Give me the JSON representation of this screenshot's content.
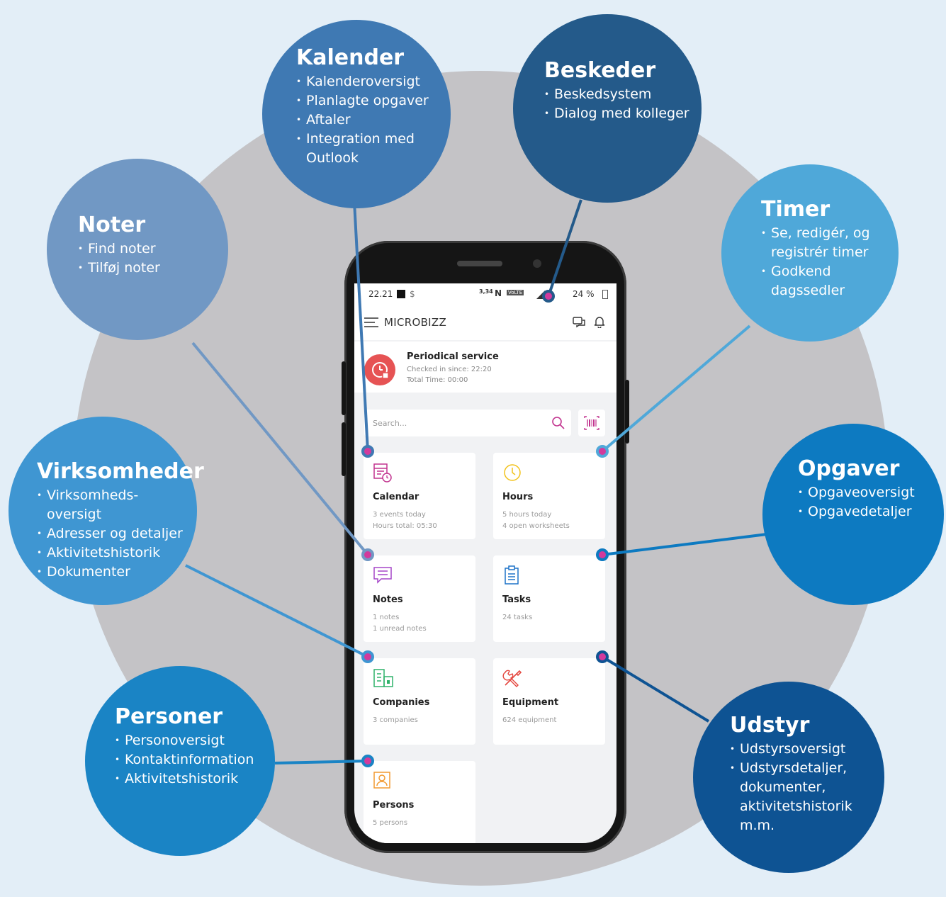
{
  "features": {
    "kalender": {
      "title": "Kalender",
      "items": [
        "Kalenderoversigt",
        "Planlagte opgaver",
        "Aftaler",
        "Integration med Outlook"
      ]
    },
    "beskeder": {
      "title": "Beskeder",
      "items": [
        "Beskedsystem",
        "Dialog med kolleger"
      ]
    },
    "noter": {
      "title": "Noter",
      "items": [
        "Find noter",
        "Tilføj noter"
      ]
    },
    "timer": {
      "title": "Timer",
      "items": [
        "Se, redigér, og registrér timer",
        "Godkend dagssedler"
      ]
    },
    "virksomheder": {
      "title": "Virksomheder",
      "items": [
        "Virksomheds-oversigt",
        "Adresser og detaljer",
        "Aktivitetshistorik",
        "Dokumenter"
      ]
    },
    "opgaver": {
      "title": "Opgaver",
      "items": [
        "Opgaveoversigt",
        "Opgavedetaljer"
      ]
    },
    "personer": {
      "title": "Personer",
      "items": [
        "Personoversigt",
        "Kontaktinformation",
        "Aktivitetshistorik"
      ]
    },
    "udstyr": {
      "title": "Udstyr",
      "items": [
        "Udstyrsoversigt",
        "Udstyrsdetaljer, dokumenter, aktivitetshistorik m.m."
      ]
    }
  },
  "app": {
    "status": {
      "time": "22.21",
      "net_speed": "3,34",
      "battery": "24 %"
    },
    "name": "MICROBIZZ",
    "checkin": {
      "title": "Periodical service",
      "since": "Checked in since: 22:20",
      "total": "Total Time: 00:00"
    },
    "search_placeholder": "Search...",
    "cards": [
      {
        "title": "Calendar",
        "line1": "3 events today",
        "line2": "Hours total: 05:30"
      },
      {
        "title": "Hours",
        "line1": "5 hours today",
        "line2": "4 open worksheets"
      },
      {
        "title": "Notes",
        "line1": "1 notes",
        "line2": "1 unread notes"
      },
      {
        "title": "Tasks",
        "line1": "24 tasks",
        "line2": ""
      },
      {
        "title": "Companies",
        "line1": "3 companies",
        "line2": ""
      },
      {
        "title": "Equipment",
        "line1": "624 equipment",
        "line2": ""
      },
      {
        "title": "Persons",
        "line1": "5 persons",
        "line2": ""
      }
    ]
  },
  "colors": {
    "background": "#e3eef7",
    "disc": "#c4c3c6",
    "kalender": "#3f79b3",
    "beskeder": "#245a8a",
    "noter": "#7198c4",
    "timer": "#4fa8d9",
    "virksomheder": "#3f96d2",
    "opgaver": "#0d7ac1",
    "personer": "#1a84c5",
    "udstyr": "#0e5393",
    "marker": "#d23a9c",
    "checkin_button": "#e65354"
  }
}
